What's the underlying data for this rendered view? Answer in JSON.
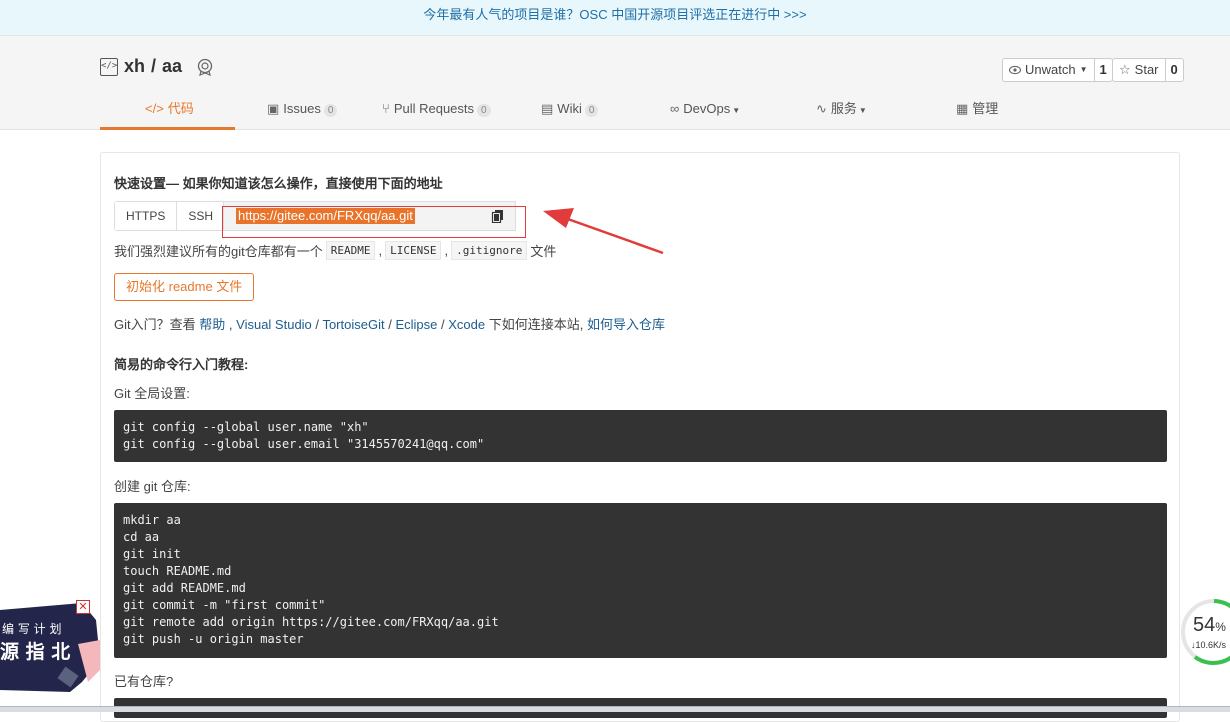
{
  "banner": {
    "text": "今年最有人气的项目是谁？OSC 中国开源项目评选正在进行中 >>>"
  },
  "repo": {
    "owner": "xh",
    "separator": "/",
    "name": "aa"
  },
  "actions": {
    "unwatch_label": "Unwatch",
    "watch_count": "1",
    "star_label": "Star",
    "star_count": "0"
  },
  "tabs": [
    {
      "label": "代码",
      "icon": "code-icon"
    },
    {
      "label": "Issues",
      "count": "0",
      "icon": "issues-icon"
    },
    {
      "label": "Pull Requests",
      "count": "0",
      "icon": "pull-request-icon"
    },
    {
      "label": "Wiki",
      "count": "0",
      "icon": "wiki-icon"
    },
    {
      "label": "DevOps",
      "icon": "devops-icon"
    },
    {
      "label": "服务",
      "icon": "service-icon"
    },
    {
      "label": "管理",
      "icon": "manage-icon"
    }
  ],
  "setup": {
    "title": "快速设置— 如果你知道该怎么操作，直接使用下面的地址",
    "https_label": "HTTPS",
    "ssh_label": "SSH",
    "url": "https://gitee.com/FRXqq/aa.git",
    "recommend_prefix": "我们强烈建议所有的git仓库都有一个",
    "readme": "README",
    "license": "LICENSE",
    "gitignore": ".gitignore",
    "recommend_suffix": "文件",
    "comma": ",",
    "init_button": "初始化 readme 文件"
  },
  "help": {
    "prefix": "Git入门？查看",
    "help": "帮助",
    "comma": ",",
    "vs": "Visual Studio",
    "slash": "/",
    "tortoise": "TortoiseGit",
    "eclipse": "Eclipse",
    "xcode": "Xcode",
    "mid": "下如何连接本站,",
    "import": "如何导入仓库"
  },
  "tutorial": {
    "title": "简易的命令行入门教程:",
    "global_label": "Git 全局设置:",
    "global_code": "git config --global user.name \"xh\"\ngit config --global user.email \"3145570241@qq.com\"",
    "create_label": "创建 git 仓库:",
    "create_code": "mkdir aa\ncd aa\ngit init\ntouch README.md\ngit add README.md\ngit commit -m \"first commit\"\ngit remote add origin https://gitee.com/FRXqq/aa.git\ngit push -u origin master",
    "existing_label": "已有仓库?"
  },
  "overlay": {
    "promo_line1": "编 写 计 划",
    "promo_line2": "源 指 北",
    "close": "✕",
    "speed_percent": "54",
    "percent_sign": "%",
    "speed_rate": "↓10.6K/s"
  },
  "colors": {
    "accent": "#e6792e",
    "link": "#1c5d8f",
    "annotation_red": "#e23b3b",
    "code_bg": "#333333"
  }
}
